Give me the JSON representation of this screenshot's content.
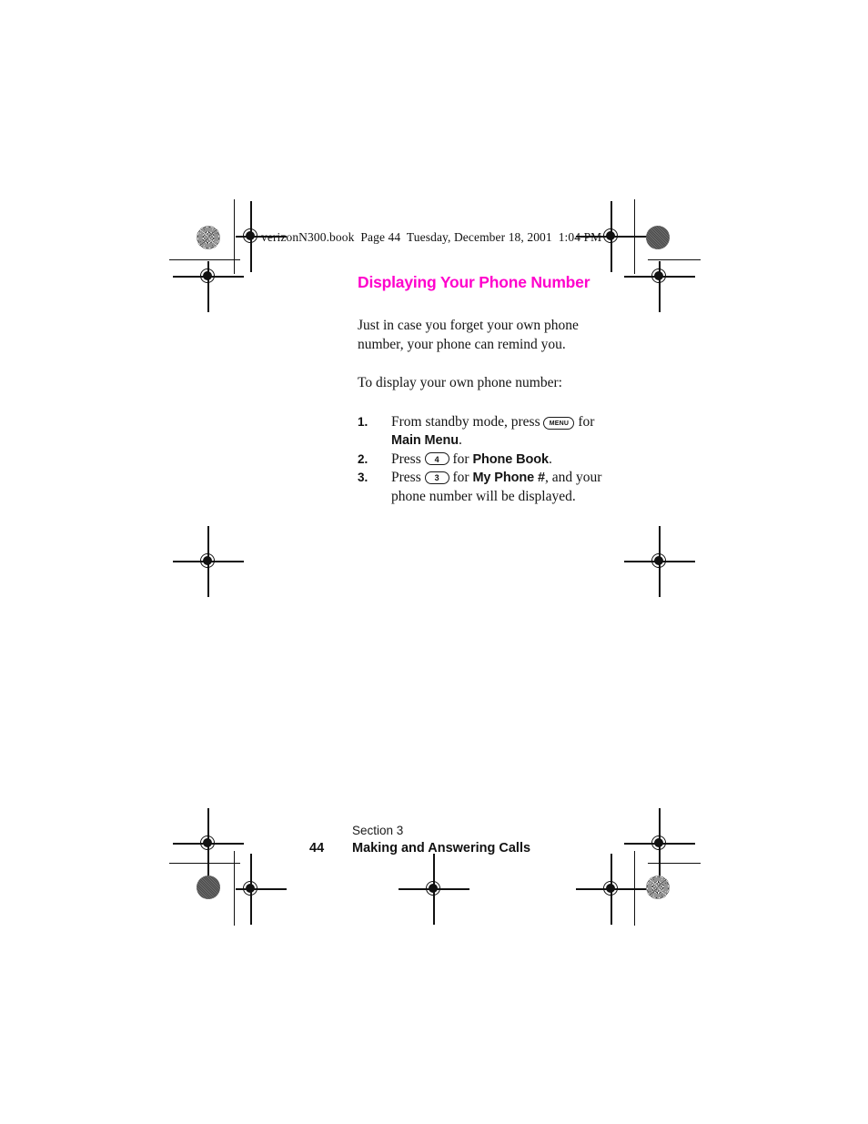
{
  "header": {
    "slug": "verizonN300.book  Page 44  Tuesday, December 18, 2001  1:04 PM"
  },
  "content": {
    "title": "Displaying Your Phone Number",
    "title_color": "#ff00cc",
    "intro": "Just in case you forget your own phone number, your phone can remind you.",
    "lead_in": "To display your own phone number:",
    "steps": [
      {
        "number": "1.",
        "text_before": "From standby mode, press",
        "key": "MENU",
        "text_mid": "for",
        "bold": "Main Menu",
        "text_after": "."
      },
      {
        "number": "2.",
        "text_before": "Press",
        "key": "4",
        "text_mid": "for",
        "bold": "Phone Book",
        "text_after": "."
      },
      {
        "number": "3.",
        "text_before": "Press",
        "key": "3",
        "text_mid": "for",
        "bold": "My Phone #",
        "text_after": ", and your phone number will be displayed."
      }
    ]
  },
  "footer": {
    "section": "Section 3",
    "page_number": "44",
    "chapter": "Making and Answering Calls"
  }
}
